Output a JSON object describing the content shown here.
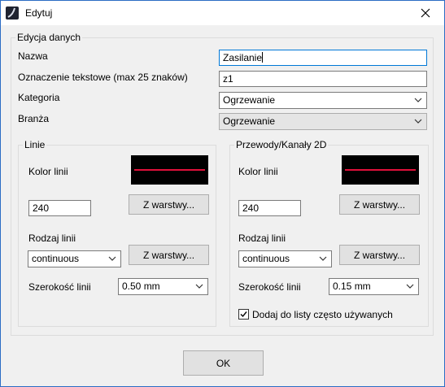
{
  "window": {
    "title": "Edytuj",
    "icon": "app-logo-icon",
    "close_icon": "close-icon"
  },
  "main_group": {
    "legend": "Edycja danych",
    "name_label": "Nazwa",
    "name_value": "Zasilanie",
    "text_label": "Oznaczenie tekstowe (max 25 znaków)",
    "text_value": "z1",
    "category_label": "Kategoria",
    "category_value": "Ogrzewanie",
    "branch_label": "Branża",
    "branch_value": "Ogrzewanie"
  },
  "lines_group": {
    "legend": "Linie",
    "color_label": "Kolor linii",
    "line_color": "#e0103a",
    "color_value": "240",
    "from_layer_1": "Z warstwy...",
    "type_label": "Rodzaj linii",
    "type_value": "continuous",
    "from_layer_2": "Z warstwy...",
    "width_label": "Szerokość linii",
    "width_value": "0.50 mm"
  },
  "ducts_group": {
    "legend": "Przewody/Kanały 2D",
    "color_label": "Kolor linii",
    "line_color": "#e0103a",
    "color_value": "240",
    "from_layer_1": "Z warstwy...",
    "type_label": "Rodzaj linii",
    "type_value": "continuous",
    "from_layer_2": "Z warstwy...",
    "width_label": "Szerokość linii",
    "width_value": "0.15 mm",
    "favorite_label": "Dodaj do listy często używanych",
    "favorite_checked": true
  },
  "ok_label": "OK",
  "colors": {
    "accent": "#0078d7",
    "border": "#2b6cc4"
  }
}
